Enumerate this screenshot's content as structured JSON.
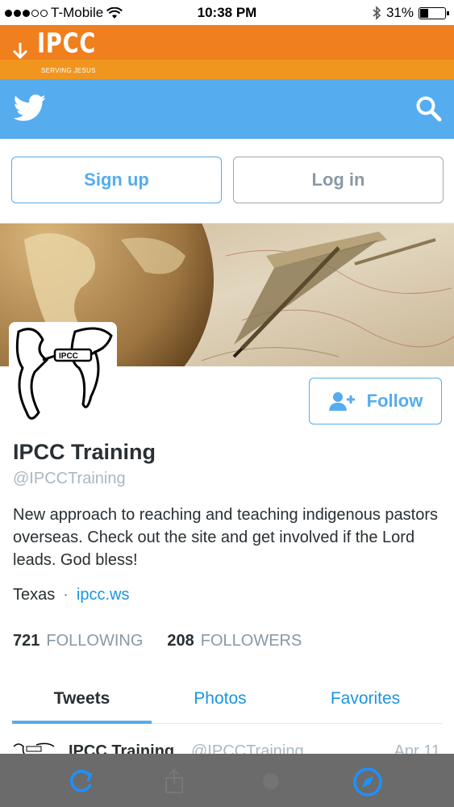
{
  "status_bar": {
    "carrier": "T-Mobile",
    "time": "10:38 PM",
    "battery": "31%",
    "battery_level": 0.31
  },
  "brand": {
    "logo": "IPCC",
    "tagline": "SERVING JESUS",
    "arrow_icon": "down-arrow-icon"
  },
  "twitter_bar": {
    "logo_icon": "twitter-bird-icon",
    "search_icon": "search-icon"
  },
  "auth": {
    "signup_label": "Sign up",
    "login_label": "Log in"
  },
  "profile": {
    "name": "IPCC Training",
    "handle": "@IPCCTraining",
    "bio": "New approach to reaching and teaching indigenous pastors overseas. Check out the site and get involved if the Lord leads. God bless!",
    "location": "Texas",
    "separator": "·",
    "website": "ipcc.ws",
    "follow_label": "Follow"
  },
  "stats": {
    "following_count": "721",
    "following_label": "FOLLOWING",
    "followers_count": "208",
    "followers_label": "FOLLOWERS"
  },
  "tabs": [
    {
      "label": "Tweets"
    },
    {
      "label": "Photos"
    },
    {
      "label": "Favorites"
    }
  ],
  "tweet_preview": {
    "name": "IPCC Training",
    "handle": "@IPCCTraining",
    "date": "Apr 11"
  },
  "bottom_bar": {
    "icons": [
      "reload-icon",
      "share-icon",
      "bookmark-icon",
      "compass-icon"
    ]
  },
  "colors": {
    "twitter_blue": "#55acee",
    "brand_orange": "#f07f1e",
    "toolbar_gray": "#6b6b6b"
  }
}
